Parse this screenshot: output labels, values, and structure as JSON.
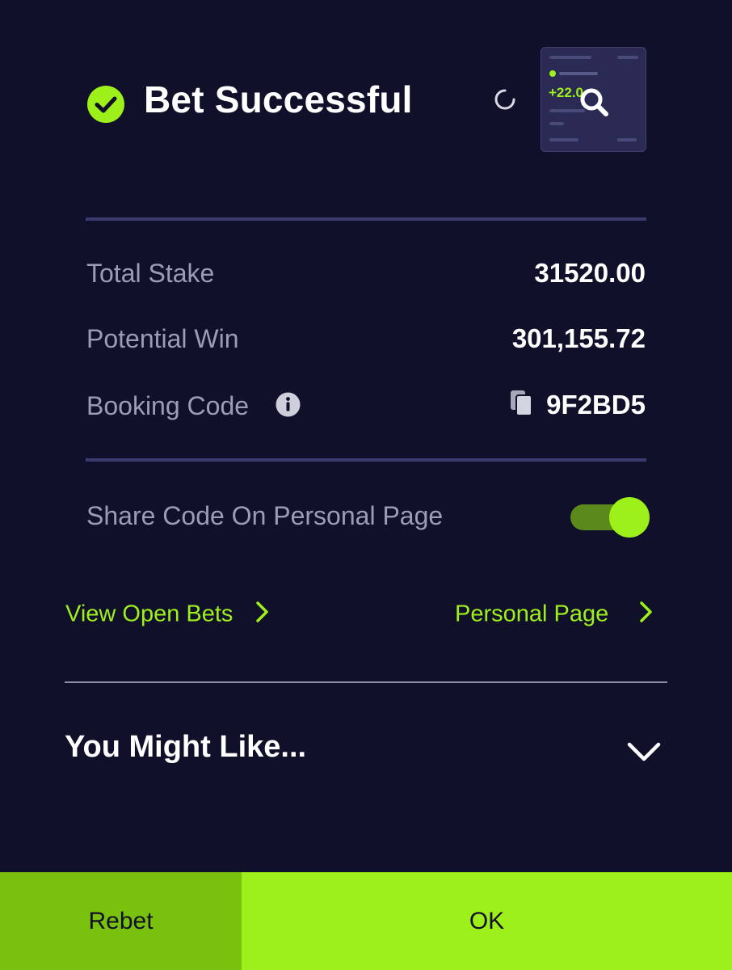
{
  "header": {
    "title": "Bet Successful",
    "status_icon": "check-circle-icon",
    "refresh_icon": "refresh-icon",
    "preview": {
      "amount": "+22.0",
      "search_icon": "search-icon"
    }
  },
  "details": {
    "total_stake_label": "Total Stake",
    "total_stake_value": "31520.00",
    "potential_win_label": "Potential Win",
    "potential_win_value": "301,155.72",
    "booking_code_label": "Booking Code",
    "booking_code_value": "9F2BD5",
    "info_icon": "info-icon",
    "copy_icon": "copy-icon"
  },
  "share": {
    "label": "Share Code On Personal Page",
    "enabled": true
  },
  "links": {
    "view_open_bets": "View Open Bets",
    "personal_page": "Personal Page"
  },
  "recommend": {
    "title": "You Might Like...",
    "expand_icon": "chevron-down-icon"
  },
  "footer": {
    "rebet_label": "Rebet",
    "ok_label": "OK"
  },
  "colors": {
    "background": "#10102a",
    "accent": "#9ef01a",
    "accent_dark": "#7ac10e",
    "muted_text": "#9c9cb6",
    "divider": "#3a3a6c"
  }
}
